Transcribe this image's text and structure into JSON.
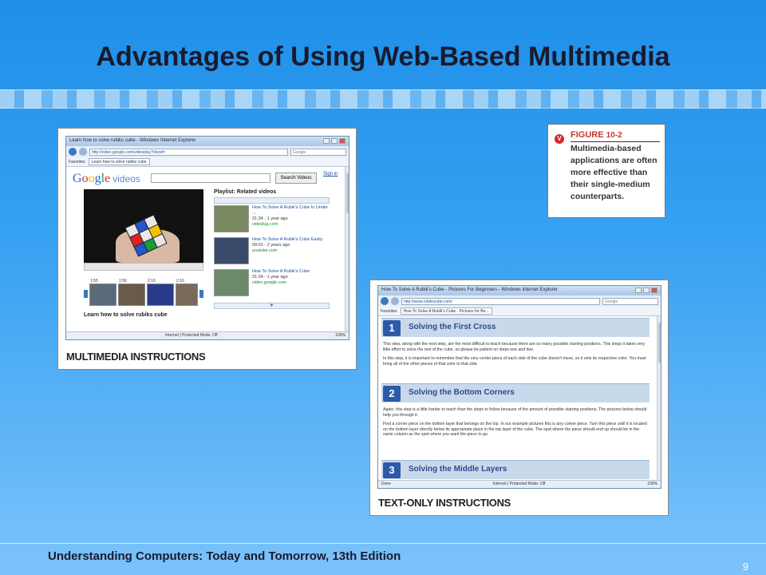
{
  "slide": {
    "title": "Advantages of Using Web-Based Multimedia",
    "footer": "Understanding Computers: Today and Tomorrow, 13th Edition",
    "page_number": "9"
  },
  "figure_box": {
    "icon": "V",
    "label": "FIGURE",
    "number": "10-2",
    "caption": "Multimedia-based applications are often more effective than their single-medium counterparts."
  },
  "multimedia_panel": {
    "caption": "MULTIMEDIA INSTRUCTIONS",
    "window_title": "Learn how to solve rubiks cube - Windows Internet Explorer",
    "url": "http://video.google.com/videoplay?docid=",
    "search_placeholder": "Google",
    "tab_favorites": "Favorites",
    "tab_label": "Learn how to solve rubiks cube",
    "search_button": "Search Videos",
    "sign_in": "Sign in",
    "playlist_title": "Playlist: Related videos",
    "playlist": [
      {
        "title": "How To Solve A Rubik's Cube In Under ...",
        "meta": "21:34 - 1 year ago",
        "source": "videolug.com"
      },
      {
        "title": "How To Solve A Rubik's Cube Easily",
        "meta": "09:01 - 2 years ago",
        "source": "youtube.com"
      },
      {
        "title": "How To Solve A Rubik's Cube",
        "meta": "21:34 - 1 year ago",
        "source": "video.google.com"
      }
    ],
    "strip_times": [
      "1:55",
      "1:56",
      "2:16",
      "2:16"
    ],
    "learn_label": "Learn how to solve rubiks cube",
    "status": "Internet | Protected Mode: Off",
    "zoom": "100%"
  },
  "text_panel": {
    "caption": "TEXT-ONLY INSTRUCTIONS",
    "window_title": "How To Solve A Rubik's Cube - Pictures For Beginners - Windows Internet Explorer",
    "url": "http://www.rubikscube.com/",
    "search_placeholder": "Google",
    "tab_favorites": "Favorites",
    "tab_label": "How To Solve A Rubik's Cube - Pictures for Be...",
    "sections": [
      {
        "num": "1",
        "heading": "Solving the First Cross",
        "para1": "This step, along with the next step, are the most difficult to teach because there are so many possible starting positions. This steps it takes very little effort to solve the rest of the cube, so please be patient on steps one and two.",
        "para2": "In this step, it is important to remember that the very center piece of each side of the cube doesn't move, so it sets its respective color. You must bring all of the other pieces of that color to that side."
      },
      {
        "num": "2",
        "heading": "Solving the Bottom Corners",
        "para1": "Again, this step is a little harder to teach than the steps to follow because of the amount of possible starting positions. The pictures below should help you through it.",
        "para2": "Find a corner piece on the bottom layer that belongs on the top. In our example pictures this is any corner piece. Turn this piece until it is located on the bottom layer directly below its appropriate place in the top layer of the cube. The spot where the piece should end up should be in the same column as the spot where you want the piece to go."
      },
      {
        "num": "3",
        "heading": "Solving the Middle Layers",
        "para1": "",
        "para2": ""
      }
    ],
    "status_left": "Done",
    "status": "Internet | Protected Mode: Off",
    "zoom": "100%"
  }
}
